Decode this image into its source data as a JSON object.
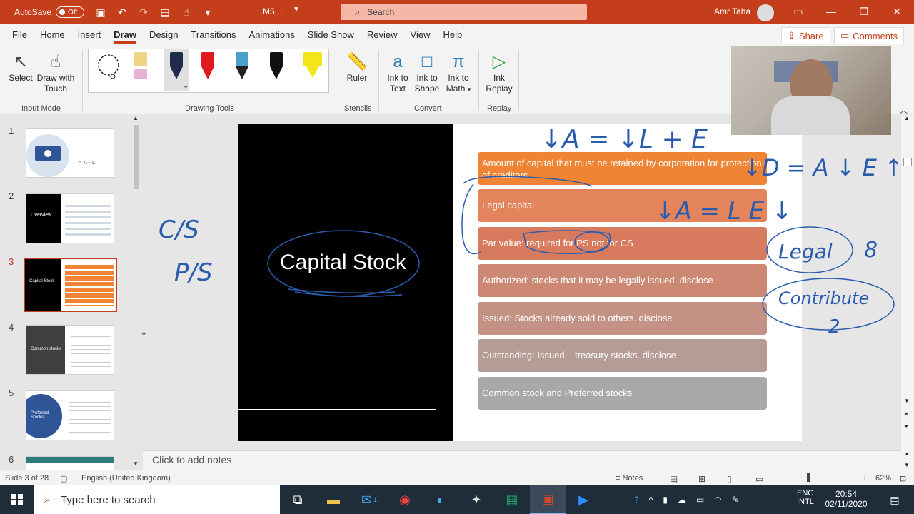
{
  "titlebar": {
    "autosave_label": "AutoSave",
    "autosave_state": "Off",
    "doc_title": "M5,...",
    "search_placeholder": "Search",
    "user_name": "Amr Taha"
  },
  "tabs": [
    "File",
    "Home",
    "Insert",
    "Draw",
    "Design",
    "Transitions",
    "Animations",
    "Slide Show",
    "Review",
    "View",
    "Help"
  ],
  "active_tab": "Draw",
  "share_label": "Share",
  "comments_label": "Comments",
  "ribbon": {
    "input_mode": {
      "label": "Input Mode",
      "select": "Select",
      "draw_touch_line1": "Draw with",
      "draw_touch_line2": "Touch"
    },
    "drawing_tools": {
      "label": "Drawing Tools"
    },
    "stencils": {
      "label": "Stencils",
      "ruler": "Ruler"
    },
    "convert": {
      "label": "Convert",
      "ink_to_text_1": "Ink to",
      "ink_to_text_2": "Text",
      "ink_to_shape_1": "Ink to",
      "ink_to_shape_2": "Shape",
      "ink_to_math_1": "Ink to",
      "ink_to_math_2": "Math"
    },
    "replay": {
      "label": "Replay",
      "ink_replay_1": "Ink",
      "ink_replay_2": "Replay"
    }
  },
  "pen_colors": [
    "#e8b0d6",
    "#1e2b4a",
    "#e0191c",
    "#4aa0c8",
    "#111111",
    "#f2e61a"
  ],
  "thumbnails": [
    {
      "num": "1"
    },
    {
      "num": "2",
      "title": "Overview"
    },
    {
      "num": "3",
      "title": "Capital Stock"
    },
    {
      "num": "4",
      "title": "Common stocks"
    },
    {
      "num": "5",
      "title": "Preferred Stocks"
    },
    {
      "num": "6"
    }
  ],
  "active_slide": 3,
  "slide": {
    "title": "Capital Stock",
    "bars": [
      {
        "text": "Amount of capital that must be retained by corporation for protection of creditors.",
        "color": "#ee8434"
      },
      {
        "text": "Legal capital",
        "color": "#e3845d"
      },
      {
        "text": "Par value: required for PS not for CS",
        "color": "#d87a5e"
      },
      {
        "text": "Authorized: stocks that it may be legally issued. disclose",
        "color": "#cc8872"
      },
      {
        "text": "Issued: Stocks already sold to others. disclose",
        "color": "#c39284"
      },
      {
        "text": "Outstanding: Issued – treasury stocks. disclose",
        "color": "#b59c94"
      },
      {
        "text": "Common stock and Preferred stocks",
        "color": "#a8a8a8"
      }
    ]
  },
  "annotations": {
    "left_cs": "C/S",
    "left_ps": "P/S",
    "eq1": "↓A = ↓L + E",
    "eq2": "↓D = A ↓ E ↑",
    "eq3": "↓A = L E ↓",
    "legal": "Legal",
    "legal_num": "8",
    "contribute": "Contribute",
    "contribute_num": "2"
  },
  "notes_placeholder": "Click to add notes",
  "status": {
    "slide_info": "Slide 3 of 28",
    "language": "English (United Kingdom)",
    "notes_label": "Notes",
    "zoom": "62%"
  },
  "taskbar": {
    "search_placeholder": "Type here to search",
    "lang1": "ENG",
    "lang2": "INTL",
    "time": "20:54",
    "date": "02/11/2020",
    "mail_badge": "1"
  }
}
